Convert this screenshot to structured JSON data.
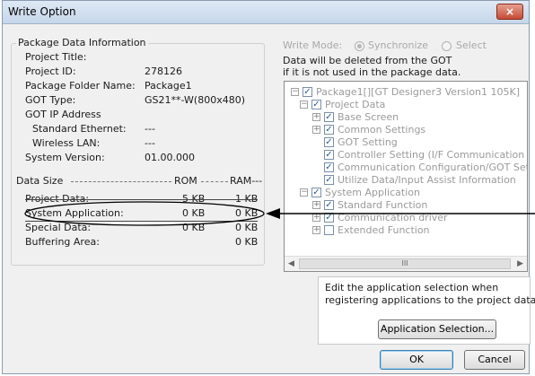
{
  "window": {
    "title": "Write Option",
    "close_glyph": "×"
  },
  "package_info": {
    "legend": "Package Data Information",
    "rows": [
      {
        "label": "Project Title:",
        "value": ""
      },
      {
        "label": "Project ID:",
        "value": "278126"
      },
      {
        "label": "Package Folder Name:",
        "value": "Package1"
      },
      {
        "label": "GOT Type:",
        "value": "GS21**-W(800x480)"
      },
      {
        "label": "GOT IP Address",
        "value": ""
      },
      {
        "label": "Standard Ethernet:",
        "value": "---"
      },
      {
        "label": "Wireless LAN:",
        "value": "---"
      },
      {
        "label": "System Version:",
        "value": "01.00.000"
      }
    ]
  },
  "data_size": {
    "header_label": "Data Size",
    "rom_label": "ROM",
    "ram_label": "RAM---",
    "rows": [
      {
        "label": "Project Data:",
        "rom": "5 KB",
        "ram": "1 KB"
      },
      {
        "label": "System Application:",
        "rom": "0 KB",
        "ram": "0 KB"
      },
      {
        "label": "Special Data:",
        "rom": "0 KB",
        "ram": "0 KB"
      },
      {
        "label": "Buffering Area:",
        "rom": "",
        "ram": "0 KB"
      }
    ]
  },
  "write_mode": {
    "label": "Write Mode:",
    "options": [
      {
        "label": "Synchronize",
        "checked": true
      },
      {
        "label": "Select",
        "checked": false
      }
    ],
    "note_line1": "Data will be deleted from the GOT",
    "note_line2": "if it is not used in the package data."
  },
  "tree": {
    "items": [
      {
        "label": "Package1[][GT Designer3 Version1 105K]",
        "expander": "−",
        "checked": true
      },
      {
        "label": "Project Data",
        "expander": "−",
        "checked": true
      },
      {
        "label": "Base Screen",
        "expander": "+",
        "checked": true
      },
      {
        "label": "Common Settings",
        "expander": "+",
        "checked": true
      },
      {
        "label": "GOT Setting",
        "expander": "",
        "checked": true
      },
      {
        "label": "Controller Setting (I/F Communication Set",
        "expander": "",
        "checked": true
      },
      {
        "label": "Communication Configuration/GOT Settin",
        "expander": "",
        "checked": true
      },
      {
        "label": "Utilize Data/Input Assist Information",
        "expander": "",
        "checked": true
      },
      {
        "label": "System Application",
        "expander": "−",
        "checked": true
      },
      {
        "label": "Standard Function",
        "expander": "+",
        "checked": true
      },
      {
        "label": "Communication driver",
        "expander": "+",
        "checked": true
      },
      {
        "label": "Extended Function",
        "expander": "+",
        "checked": false
      }
    ],
    "scroll_left": "◀",
    "scroll_right": "▶",
    "scroll_thumb": "III"
  },
  "app_info": {
    "line1": "Edit the application selection when",
    "line2": "registering applications to the project data.",
    "button": "Application Selection..."
  },
  "buttons": {
    "ok": "OK",
    "cancel": "Cancel"
  }
}
